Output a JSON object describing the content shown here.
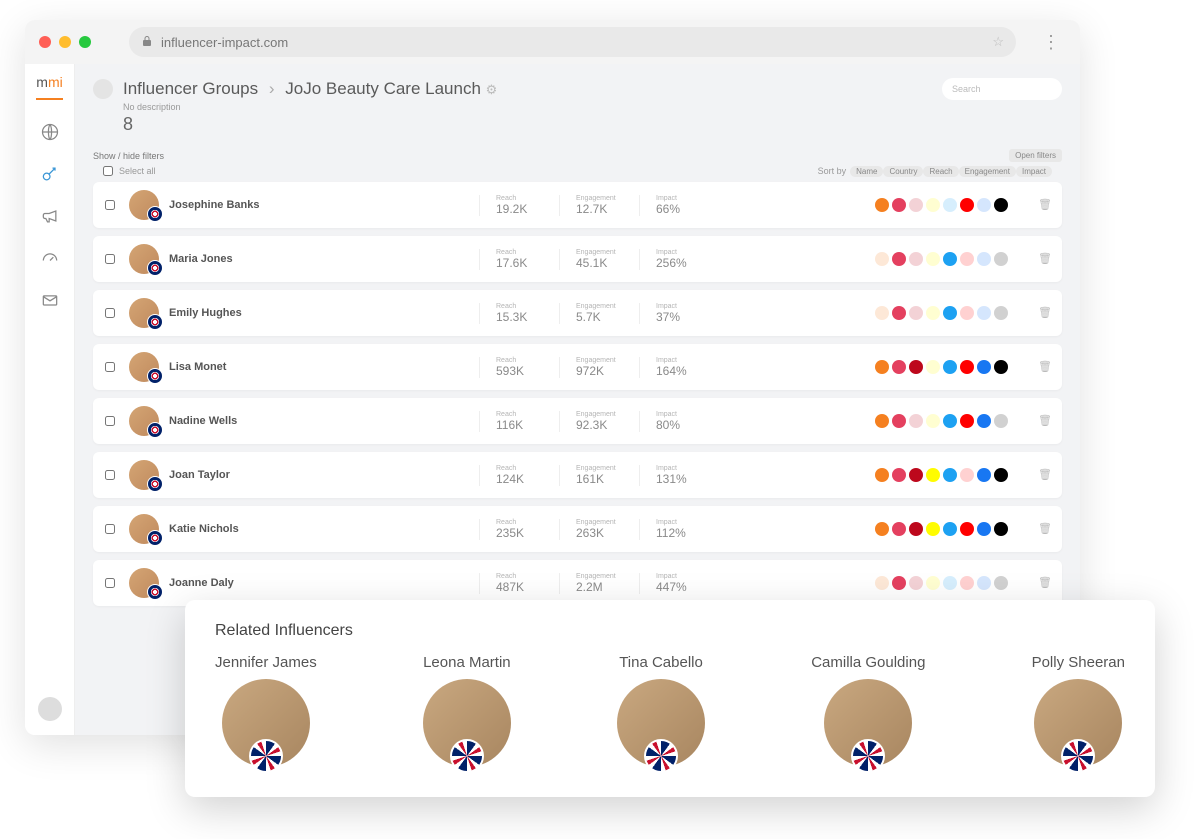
{
  "url_bar": {
    "domain": "influencer-impact.com"
  },
  "logo": {
    "m1": "m",
    "m2": "mi"
  },
  "breadcrumb": {
    "root": "Influencer Groups",
    "current": "JoJo Beauty Care Launch"
  },
  "description": "No description",
  "count": "8",
  "search_placeholder": "Search",
  "filters": {
    "toggle": "Show / hide filters",
    "open": "Open filters"
  },
  "table_header": {
    "select_all": "Select all",
    "sort_by": "Sort by",
    "sort_opts": [
      "Name",
      "Country",
      "Reach",
      "Engagement",
      "Impact"
    ]
  },
  "stat_labels": {
    "reach": "Reach",
    "engagement": "Engagement",
    "impact": "Impact"
  },
  "influencers": [
    {
      "name": "Josephine Banks",
      "reach": "19.2K",
      "engagement": "12.7K",
      "impact": "66%",
      "socials": [
        [
          "blog",
          true
        ],
        [
          "insta",
          true
        ],
        [
          "pin",
          false
        ],
        [
          "snap",
          false
        ],
        [
          "tw",
          false
        ],
        [
          "yt",
          true
        ],
        [
          "fb",
          false
        ],
        [
          "tik",
          true
        ]
      ]
    },
    {
      "name": "Maria Jones",
      "reach": "17.6K",
      "engagement": "45.1K",
      "impact": "256%",
      "socials": [
        [
          "blog",
          false
        ],
        [
          "insta",
          true
        ],
        [
          "pin",
          false
        ],
        [
          "snap",
          false
        ],
        [
          "tw",
          true
        ],
        [
          "yt",
          false
        ],
        [
          "fb",
          false
        ],
        [
          "tik",
          false
        ]
      ]
    },
    {
      "name": "Emily Hughes",
      "reach": "15.3K",
      "engagement": "5.7K",
      "impact": "37%",
      "socials": [
        [
          "blog",
          false
        ],
        [
          "insta",
          true
        ],
        [
          "pin",
          false
        ],
        [
          "snap",
          false
        ],
        [
          "tw",
          true
        ],
        [
          "yt",
          false
        ],
        [
          "fb",
          false
        ],
        [
          "tik",
          false
        ]
      ]
    },
    {
      "name": "Lisa Monet",
      "reach": "593K",
      "engagement": "972K",
      "impact": "164%",
      "socials": [
        [
          "blog",
          true
        ],
        [
          "insta",
          true
        ],
        [
          "pin",
          true
        ],
        [
          "snap",
          false
        ],
        [
          "tw",
          true
        ],
        [
          "yt",
          true
        ],
        [
          "fb",
          true
        ],
        [
          "tik",
          true
        ]
      ]
    },
    {
      "name": "Nadine Wells",
      "reach": "116K",
      "engagement": "92.3K",
      "impact": "80%",
      "socials": [
        [
          "blog",
          true
        ],
        [
          "insta",
          true
        ],
        [
          "pin",
          false
        ],
        [
          "snap",
          false
        ],
        [
          "tw",
          true
        ],
        [
          "yt",
          true
        ],
        [
          "fb",
          true
        ],
        [
          "tik",
          false
        ]
      ]
    },
    {
      "name": "Joan Taylor",
      "reach": "124K",
      "engagement": "161K",
      "impact": "131%",
      "socials": [
        [
          "blog",
          true
        ],
        [
          "insta",
          true
        ],
        [
          "pin",
          true
        ],
        [
          "snap",
          true
        ],
        [
          "tw",
          true
        ],
        [
          "yt",
          false
        ],
        [
          "fb",
          true
        ],
        [
          "tik",
          true
        ]
      ]
    },
    {
      "name": "Katie Nichols",
      "reach": "235K",
      "engagement": "263K",
      "impact": "112%",
      "socials": [
        [
          "blog",
          true
        ],
        [
          "insta",
          true
        ],
        [
          "pin",
          true
        ],
        [
          "snap",
          true
        ],
        [
          "tw",
          true
        ],
        [
          "yt",
          true
        ],
        [
          "fb",
          true
        ],
        [
          "tik",
          true
        ]
      ]
    },
    {
      "name": "Joanne Daly",
      "reach": "487K",
      "engagement": "2.2M",
      "impact": "447%",
      "socials": [
        [
          "blog",
          false
        ],
        [
          "insta",
          true
        ],
        [
          "pin",
          false
        ],
        [
          "snap",
          false
        ],
        [
          "tw",
          false
        ],
        [
          "yt",
          false
        ],
        [
          "fb",
          false
        ],
        [
          "tik",
          false
        ]
      ]
    }
  ],
  "related": {
    "title": "Related Influencers",
    "items": [
      "Jennifer James",
      "Leona Martin",
      "Tina Cabello",
      "Camilla Goulding",
      "Polly Sheeran"
    ]
  }
}
